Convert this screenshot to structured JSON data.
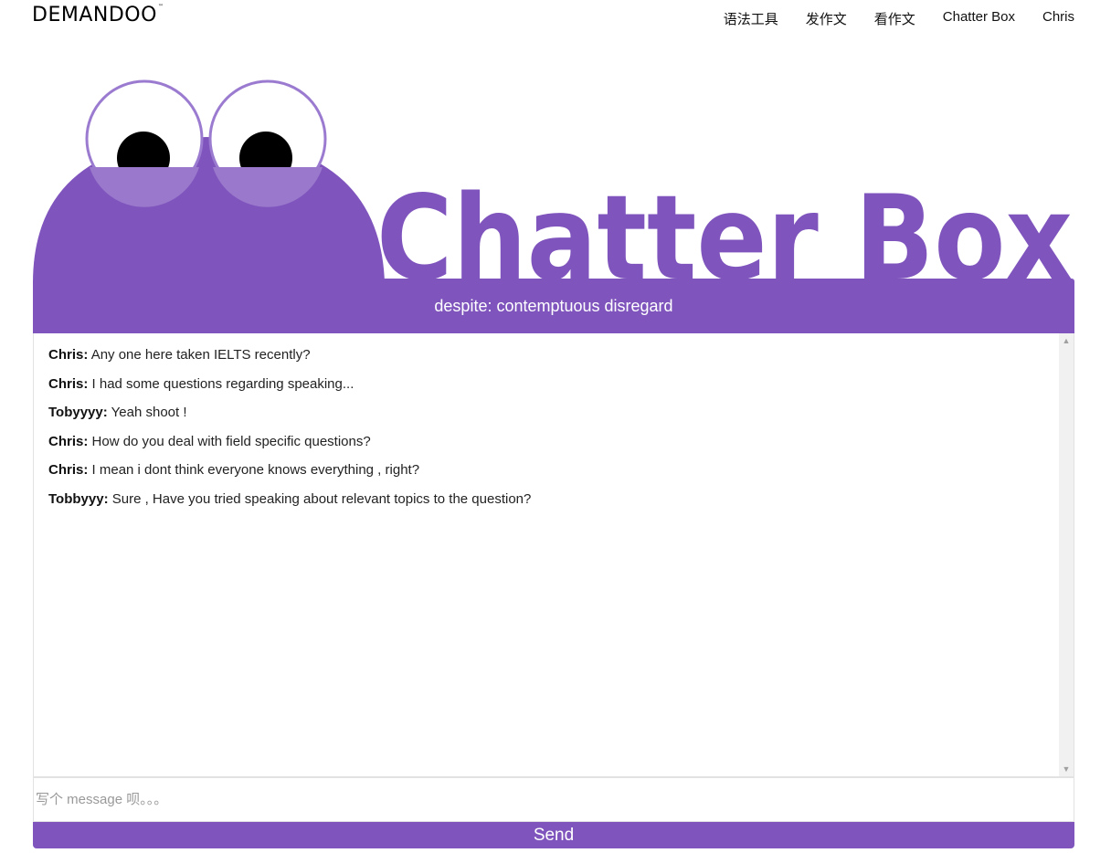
{
  "brand": {
    "logo_text": "DEMANDOO",
    "logo_tm": "™"
  },
  "nav": [
    {
      "label": "语法工具"
    },
    {
      "label": "发作文"
    },
    {
      "label": "看作文"
    },
    {
      "label": "Chatter Box"
    },
    {
      "label": "Chris"
    }
  ],
  "hero": {
    "title": "Chatter Box",
    "accent_color": "#7f55bd"
  },
  "topic": {
    "text": "despite: contemptuous disregard"
  },
  "messages": [
    {
      "sender": "Chris:",
      "text": "Any one here taken IELTS recently?"
    },
    {
      "sender": "Chris:",
      "text": "I had some questions regarding speaking..."
    },
    {
      "sender": "Tobyyyy:",
      "text": "Yeah shoot !"
    },
    {
      "sender": "Chris:",
      "text": "How do you deal with field specific questions?"
    },
    {
      "sender": "Chris:",
      "text": "I mean i dont think everyone knows everything , right?"
    },
    {
      "sender": "Tobbyyy:",
      "text": "Sure , Have you tried speaking about relevant topics to the question?"
    }
  ],
  "composer": {
    "placeholder": "写个 message 呗。。。",
    "value": ""
  },
  "send_button": {
    "label": "Send"
  }
}
